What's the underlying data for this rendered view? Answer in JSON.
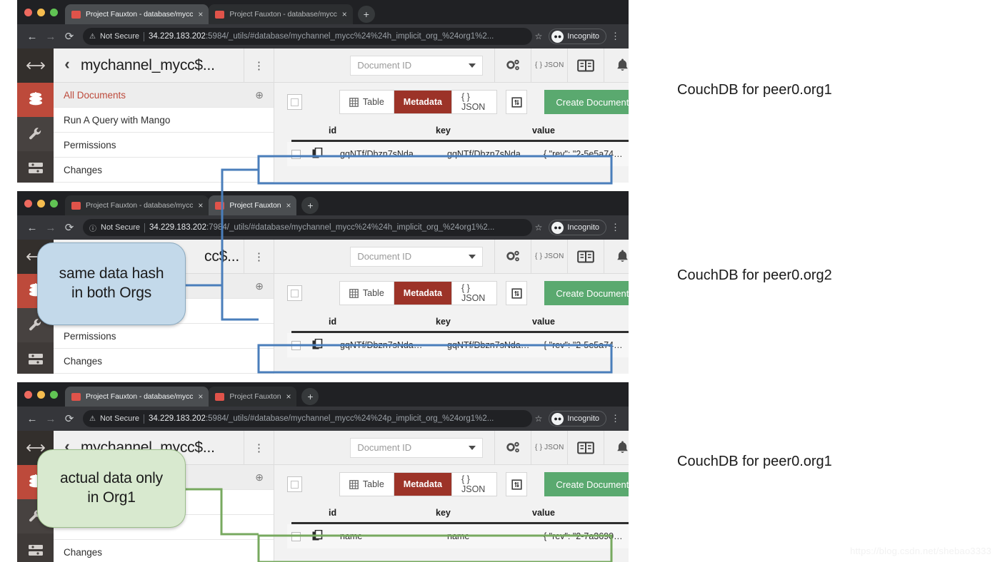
{
  "windows": [
    {
      "tabs": [
        {
          "title": "Project Fauxton - database/mycc",
          "close": "×"
        },
        {
          "title": "Project Fauxton - database/mycc",
          "close": "×"
        }
      ],
      "newtab_label": "+",
      "omnibox": {
        "back": "←",
        "forward": "→",
        "reload": "⟳",
        "warn_icon": "⚠",
        "security_label": "Not Secure",
        "host": "34.229.183.202",
        "path": ":5984/_utils/#database/mychannel_mycc%24%24h_implicit_org_%24org1%2...",
        "star": "☆",
        "profile_label": "Incognito",
        "menu": "⋮"
      },
      "sidebar_icons": [
        "resize-icon",
        "database-icon",
        "wrench-icon",
        "setup-icon"
      ],
      "db_header": {
        "back": "‹",
        "name": "mychannel_mycc$...",
        "menu": "⋮"
      },
      "nav_items": [
        {
          "label": "All Documents",
          "active": true,
          "plus": "⊕"
        },
        {
          "label": "Run A Query with Mango",
          "active": false
        },
        {
          "label": "Permissions",
          "active": false
        },
        {
          "label": "Changes",
          "active": false
        }
      ],
      "toolbar": {
        "docid_placeholder": "Document ID",
        "gear_icon": "gears-icon",
        "json_label": "{ } JSON",
        "book_icon": "book-icon",
        "bell_icon": "bell-icon"
      },
      "actions": {
        "segments": [
          {
            "label": "Table",
            "active": false,
            "icon": "grid-icon"
          },
          {
            "label": "Metadata",
            "active": true
          },
          {
            "label": "{ } JSON",
            "active": false
          }
        ],
        "toggle_icon": "collapse-icon",
        "create_label": "Create Document"
      },
      "table": {
        "columns": [
          "id",
          "key",
          "value"
        ],
        "rows": [
          {
            "id": "gqNTf/Dbzn7sNda…",
            "key": "gqNTf/Dbzn7sNda…",
            "value": "{ \"rev\": \"2-5e5a74…"
          }
        ]
      },
      "annotation": "CouchDB for peer0.org1"
    },
    {
      "tabs": [
        {
          "title": "Project Fauxton - database/mycc",
          "close": "×"
        },
        {
          "title": "Project Fauxton",
          "close": "×"
        }
      ],
      "newtab_label": "+",
      "omnibox": {
        "back": "←",
        "forward": "→",
        "reload": "⟳",
        "warn_icon": "ⓘ",
        "security_label": "Not Secure",
        "host": "34.229.183.202",
        "path": ":7984/_utils/#database/mychannel_mycc%24%24h_implicit_org_%24org1%2...",
        "star": "☆",
        "profile_label": "Incognito",
        "menu": "⋮"
      },
      "sidebar_icons": [
        "resize-icon",
        "database-icon",
        "wrench-icon",
        "setup-icon"
      ],
      "db_header": {
        "back": "‹",
        "name": "cc$...",
        "menu": "⋮"
      },
      "nav_items": [
        {
          "label": "",
          "active": true,
          "plus": "⊕"
        },
        {
          "label": "",
          "active": false
        },
        {
          "label": "Permissions",
          "active": false
        },
        {
          "label": "Changes",
          "active": false
        }
      ],
      "toolbar": {
        "docid_placeholder": "Document ID",
        "gear_icon": "gears-icon",
        "json_label": "{ } JSON",
        "book_icon": "book-icon",
        "bell_icon": "bell-icon"
      },
      "actions": {
        "segments": [
          {
            "label": "Table",
            "active": false,
            "icon": "grid-icon"
          },
          {
            "label": "Metadata",
            "active": true
          },
          {
            "label": "{ } JSON",
            "active": false
          }
        ],
        "toggle_icon": "collapse-icon",
        "create_label": "Create Document"
      },
      "table": {
        "columns": [
          "id",
          "key",
          "value"
        ],
        "rows": [
          {
            "id": "gqNTf/Dbzn7sNda…",
            "key": "gqNTf/Dbzn7sNda…",
            "value": "{ \"rev\": \"2-5e5a74…"
          }
        ]
      },
      "annotation": "CouchDB for peer0.org2"
    },
    {
      "tabs": [
        {
          "title": "Project Fauxton - database/mycc",
          "close": "×"
        },
        {
          "title": "Project Fauxton",
          "close": "×"
        }
      ],
      "newtab_label": "+",
      "omnibox": {
        "back": "←",
        "forward": "→",
        "reload": "⟳",
        "warn_icon": "⚠",
        "security_label": "Not Secure",
        "host": "34.229.183.202",
        "path": ":5984/_utils/#database/mychannel_mycc%24%24p_implicit_org_%24org1%2...",
        "star": "☆",
        "profile_label": "Incognito",
        "menu": "⋮"
      },
      "sidebar_icons": [
        "resize-icon",
        "database-icon",
        "wrench-icon",
        "setup-icon"
      ],
      "db_header": {
        "back": "‹",
        "name": "mychannel_mycc$...",
        "menu": "⋮"
      },
      "nav_items": [
        {
          "label": "",
          "active": true,
          "plus": "⊕"
        },
        {
          "label": "",
          "active": false
        },
        {
          "label": "",
          "active": false
        },
        {
          "label": "Changes",
          "active": false
        }
      ],
      "toolbar": {
        "docid_placeholder": "Document ID",
        "gear_icon": "gears-icon",
        "json_label": "{ } JSON",
        "book_icon": "book-icon",
        "bell_icon": "bell-icon"
      },
      "actions": {
        "segments": [
          {
            "label": "Table",
            "active": false,
            "icon": "grid-icon"
          },
          {
            "label": "Metadata",
            "active": true
          },
          {
            "label": "{ } JSON",
            "active": false
          }
        ],
        "toggle_icon": "collapse-icon",
        "create_label": "Create Document"
      },
      "table": {
        "columns": [
          "id",
          "key",
          "value"
        ],
        "rows": [
          {
            "id": "name",
            "key": "name",
            "value": "{ \"rev\": \"2-7a3690…"
          }
        ]
      },
      "annotation": "CouchDB for peer0.org1"
    }
  ],
  "callouts": {
    "blue": {
      "line1": "same data hash",
      "line2": "in both Orgs",
      "color": "#c3d9ea"
    },
    "green": {
      "line1": "actual data only",
      "line2": "in Org1",
      "color": "#d8e9cf"
    }
  },
  "connector_colors": {
    "blue": "#4a7ebb",
    "green": "#77a95f"
  },
  "watermark": "https://blog.csdn.net/shebao3333"
}
